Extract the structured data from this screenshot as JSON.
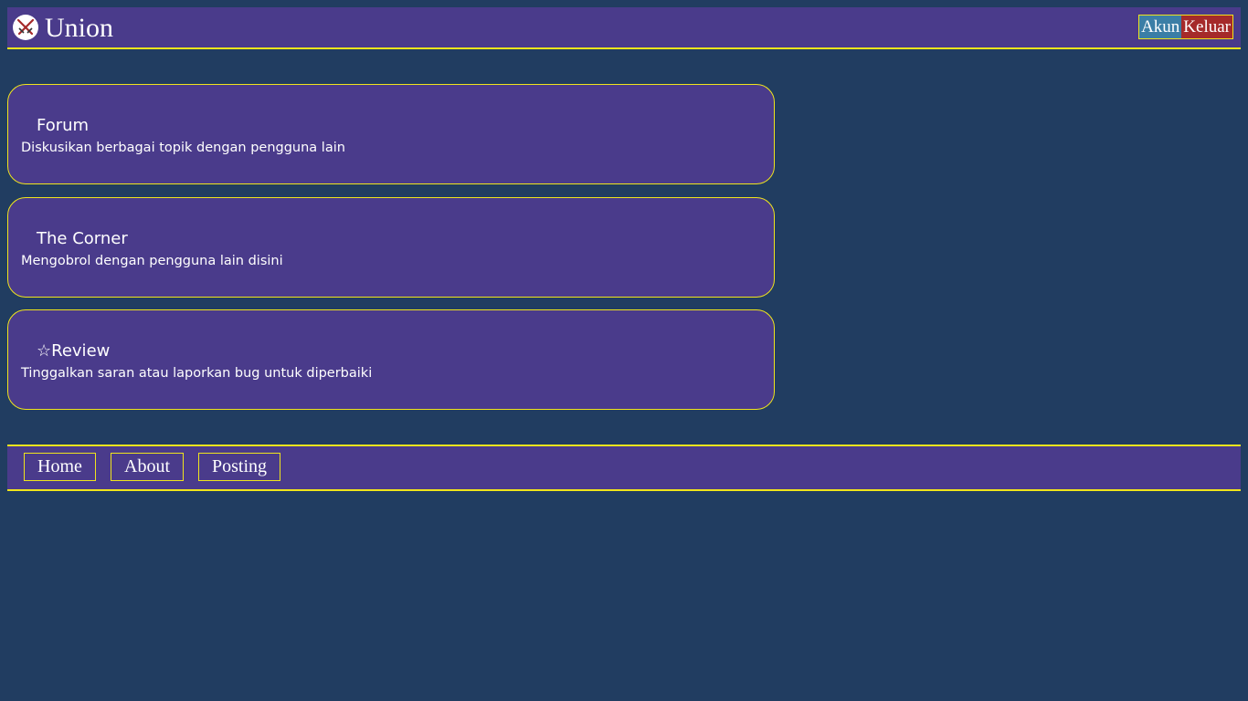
{
  "header": {
    "logo_icon": "crossed-swords-icon",
    "title": "Union",
    "akun_label": "Akun",
    "keluar_label": "Keluar"
  },
  "cards": [
    {
      "title": "Forum",
      "description": "Diskusikan berbagai topik dengan pengguna lain"
    },
    {
      "title": "The Corner",
      "description": "Mengobrol dengan pengguna lain disini"
    },
    {
      "title": "☆Review",
      "description": "Tinggalkan saran atau laporkan bug untuk diperbaiki"
    }
  ],
  "footer": {
    "home_label": "Home",
    "about_label": "About",
    "posting_label": "Posting"
  },
  "colors": {
    "background": "#213d61",
    "panel": "#4a3b8b",
    "accent_border": "#f0e51c",
    "akun_bg": "#3b7ea6",
    "keluar_bg": "#a52a2a",
    "text": "#ffffff"
  }
}
